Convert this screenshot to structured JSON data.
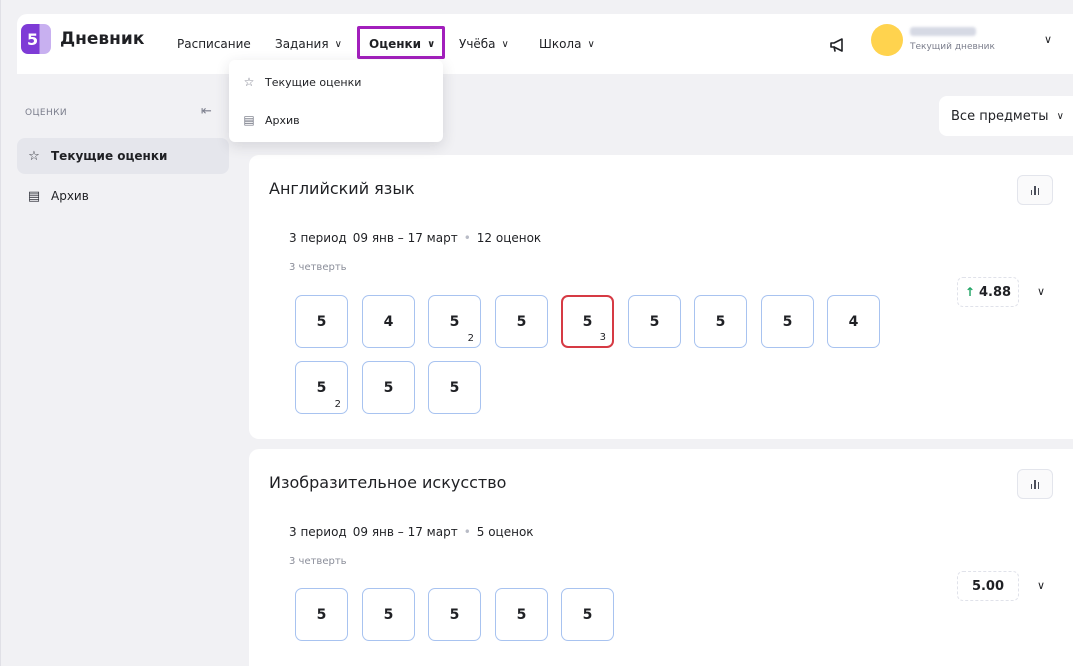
{
  "header": {
    "logo_number": "5",
    "logo_text": "Дневник",
    "nav": [
      {
        "label": "Расписание"
      },
      {
        "label": "Задания"
      },
      {
        "label": "Оценки"
      },
      {
        "label": "Учёба"
      },
      {
        "label": "Школа"
      }
    ],
    "user_subtitle": "Текущий дневник"
  },
  "dropdown": {
    "items": [
      {
        "label": "Текущие оценки",
        "icon": "star-icon"
      },
      {
        "label": "Архив",
        "icon": "archive-icon"
      }
    ]
  },
  "sidebar": {
    "title": "ОЦЕНКИ",
    "items": [
      {
        "label": "Текущие оценки",
        "icon": "star-icon",
        "selected": true
      },
      {
        "label": "Архив",
        "icon": "archive-icon",
        "selected": false
      }
    ]
  },
  "filter": {
    "label": "Все предметы"
  },
  "subjects": [
    {
      "name": "Английский язык",
      "period": "3 период",
      "dates": "09 янв – 17 март",
      "count": "12 оценок",
      "quarter": "3 четверть",
      "average": "4.88",
      "trend": "up",
      "grades": [
        {
          "value": "5",
          "weight": ""
        },
        {
          "value": "4",
          "weight": ""
        },
        {
          "value": "5",
          "weight": "2"
        },
        {
          "value": "5",
          "weight": ""
        },
        {
          "value": "5",
          "weight": "3",
          "highlight": true
        },
        {
          "value": "5",
          "weight": ""
        },
        {
          "value": "5",
          "weight": ""
        },
        {
          "value": "5",
          "weight": ""
        },
        {
          "value": "4",
          "weight": ""
        },
        {
          "value": "5",
          "weight": "2"
        },
        {
          "value": "5",
          "weight": ""
        },
        {
          "value": "5",
          "weight": ""
        }
      ]
    },
    {
      "name": "Изобразительное искусство",
      "period": "3 период",
      "dates": "09 янв – 17 март",
      "count": "5 оценок",
      "quarter": "3 четверть",
      "average": "5.00",
      "trend": "none",
      "grades": [
        {
          "value": "5",
          "weight": ""
        },
        {
          "value": "5",
          "weight": ""
        },
        {
          "value": "5",
          "weight": ""
        },
        {
          "value": "5",
          "weight": ""
        },
        {
          "value": "5",
          "weight": ""
        }
      ]
    }
  ],
  "colors": {
    "accent_purple": "#a21fbc",
    "logo_purple": "#7e3bd6",
    "grade_border": "#a8c3f0",
    "grade_highlight": "#d63a44",
    "trend_up": "#1fa464",
    "avatar": "#ffd34e"
  }
}
